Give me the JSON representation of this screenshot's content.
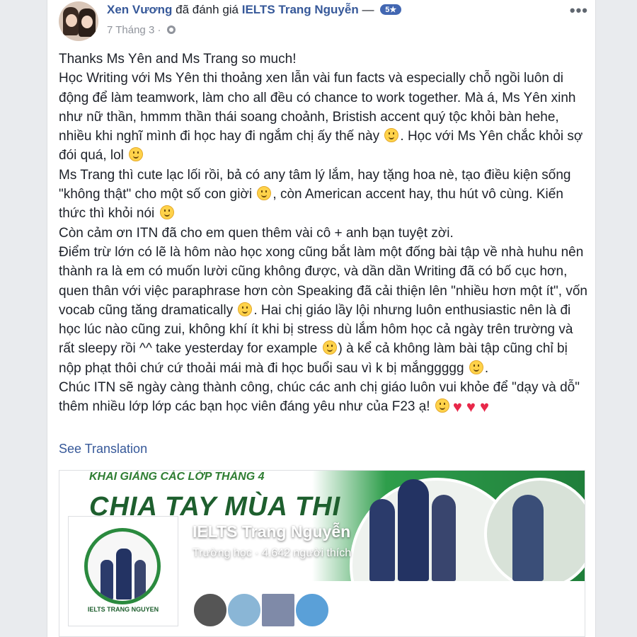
{
  "post": {
    "author": "Xen Vương",
    "action": "đã đánh giá",
    "page_name": "IELTS Trang Nguyễn",
    "dash": "—",
    "rating": "5★",
    "date": "7 Tháng 3",
    "dot": "·",
    "more": "•••",
    "paragraphs": [
      [
        "Thanks Ms Yên and Ms Trang so much!"
      ],
      [
        "Học Writing với Ms Yên thi thoảng xen lẫn vài fun facts và especially chỗ ngồi luôn di động để làm teamwork, làm cho all đều có chance to work together. Mà á, Ms Yên xinh như nữ thần, hmmm thần thái soang choảnh, Bristish accent quý tộc khỏi bàn hehe, nhiều khi nghĩ mình đi học hay đi ngắm chị ấy thế này ",
        ". Học với Ms Yên chắc khỏi sợ đói quá, lol "
      ],
      [
        "Ms Trang thì cute lạc lối rồi, bả có any tâm lý lắm, hay tặng hoa nè, tạo điều kiện sống \"không thật\" cho một số con giời ",
        ", còn American accent hay, thu hút vô cùng. Kiến thức thì khỏi nói "
      ],
      [
        "Còn cảm ơn ITN đã cho em quen thêm vài cô + anh bạn tuyệt zời."
      ],
      [
        "Điểm trừ lớn có lẽ là hôm nào học xong cũng bắt làm một đống bài tập về nhà huhu nên thành ra là em có muốn lười cũng không được, và dần dần Writing đã có bố cục hơn, quen thân với việc paraphrase hơn còn Speaking đã cải thiện lên \"nhiều hơn một ít\", vốn vocab cũng tăng dramatically ",
        ". Hai chị giáo lầy lội nhưng luôn enthusiastic nên là đi học lúc nào cũng zui, không khí ít khi bị stress dù lắm hôm học cả ngày trên trường và rất sleepy rồi ^^ take yesterday for example ",
        ") à kể cả không làm bài tập cũng chỉ bị nộp phạt thôi chứ cứ thoải mái mà đi học buổi sau vì k bị mắnggggg ",
        "."
      ],
      [
        "Chúc ITN sẽ ngày càng thành công, chúc các anh chị giáo luôn vui khỏe để \"dạy và dỗ\" thêm nhiều lớp lớp các bạn học viên đáng yêu như của F23 ạ! "
      ]
    ],
    "see_translation": "See Translation"
  },
  "page_card": {
    "cover_subtitle": "KHAI GIẢNG CÁC LỚP THÁNG 4",
    "cover_title": "CHIA TAY MÙA THI",
    "name": "IELTS Trang Nguyễn",
    "category": "Trường học · 4.642 người thích",
    "logo_text": "IELTS TRANG NGUYEN"
  },
  "colors": {
    "link": "#365899",
    "brand_green": "#2a8a3e",
    "heart": "#e8284a"
  }
}
